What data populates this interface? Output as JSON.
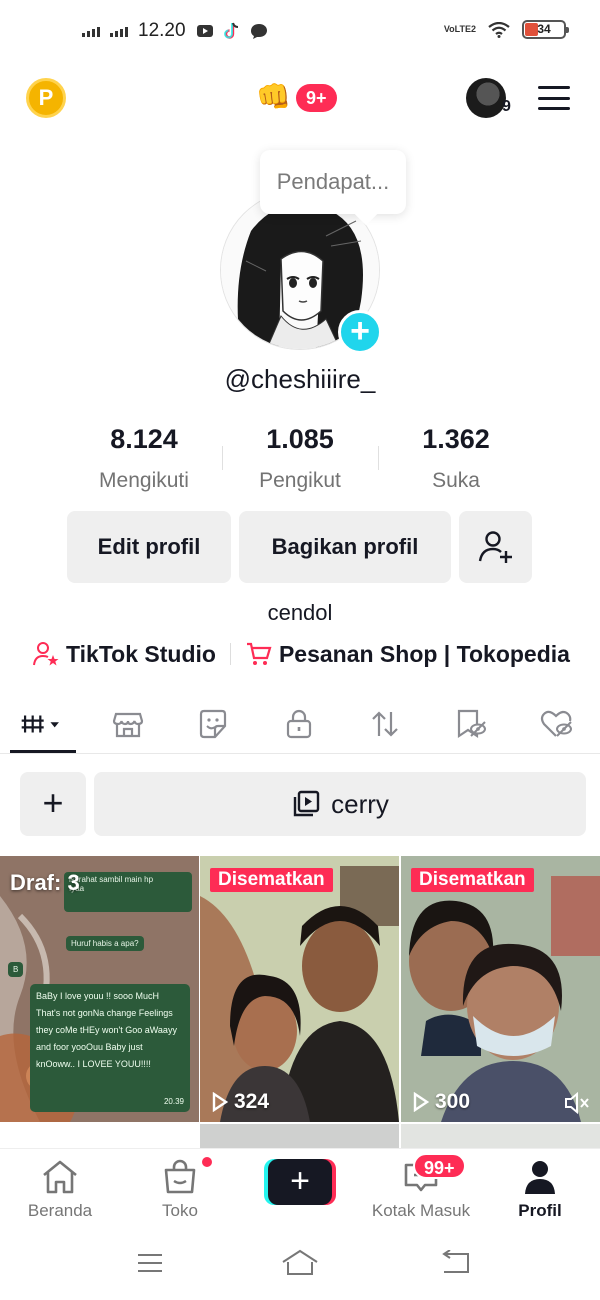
{
  "status_bar": {
    "time": "12.20",
    "volte": "VoLTE2",
    "battery": "34",
    "battery_level": 0.34
  },
  "top_bar": {
    "coin_label": "P",
    "notification_badge": "9+",
    "account_count": "9",
    "menu_icon": "hamburger-menu-icon"
  },
  "profile": {
    "tooltip": "Pendapat...",
    "username": "@cheshiiire_",
    "stats": [
      {
        "value": "8.124",
        "label": "Mengikuti"
      },
      {
        "value": "1.085",
        "label": "Pengikut"
      },
      {
        "value": "1.362",
        "label": "Suka"
      }
    ],
    "edit_button": "Edit profil",
    "share_button": "Bagikan profil",
    "bio": "cendol",
    "links": {
      "studio": "TikTok Studio",
      "shop": "Pesanan Shop | Tokopedia"
    }
  },
  "tabs": [
    {
      "icon": "videos-grid-icon",
      "active": true
    },
    {
      "icon": "shop-icon",
      "active": false
    },
    {
      "icon": "sticker-icon",
      "active": false
    },
    {
      "icon": "lock-icon",
      "active": false
    },
    {
      "icon": "repost-icon",
      "active": false
    },
    {
      "icon": "favorites-icon",
      "active": false
    },
    {
      "icon": "liked-icon",
      "active": false
    }
  ],
  "actions": {
    "add_label": "+",
    "collection_name": "cerry"
  },
  "videos": [
    {
      "drafts": "Draf: 3",
      "chat": {
        "b1": "istirahat sambil main hp",
        "b2": "Iyaa",
        "b3": "Huruf habis a apa?",
        "b4": "B",
        "message": "BaBy I love youu !! sooo MucH That's not gonNa change Feelings they coMe tHEy won't Goo aWaayy and foor yooOuu Baby just knOoww.. I LOVEE YOUU!!!!",
        "time": "20.39"
      }
    },
    {
      "pinned": "Disematkan",
      "views": "324"
    },
    {
      "pinned": "Disematkan",
      "views": "300",
      "muted": true
    }
  ],
  "bottom_nav": {
    "home": "Beranda",
    "shop": "Toko",
    "create": "+",
    "inbox": "Kotak Masuk",
    "inbox_badge": "99+",
    "profile": "Profil"
  },
  "colors": {
    "accent": "#fe2c55",
    "cyan": "#25f4ee",
    "text": "#161823",
    "secondary_text": "#737373",
    "button_bg": "#efefef"
  }
}
